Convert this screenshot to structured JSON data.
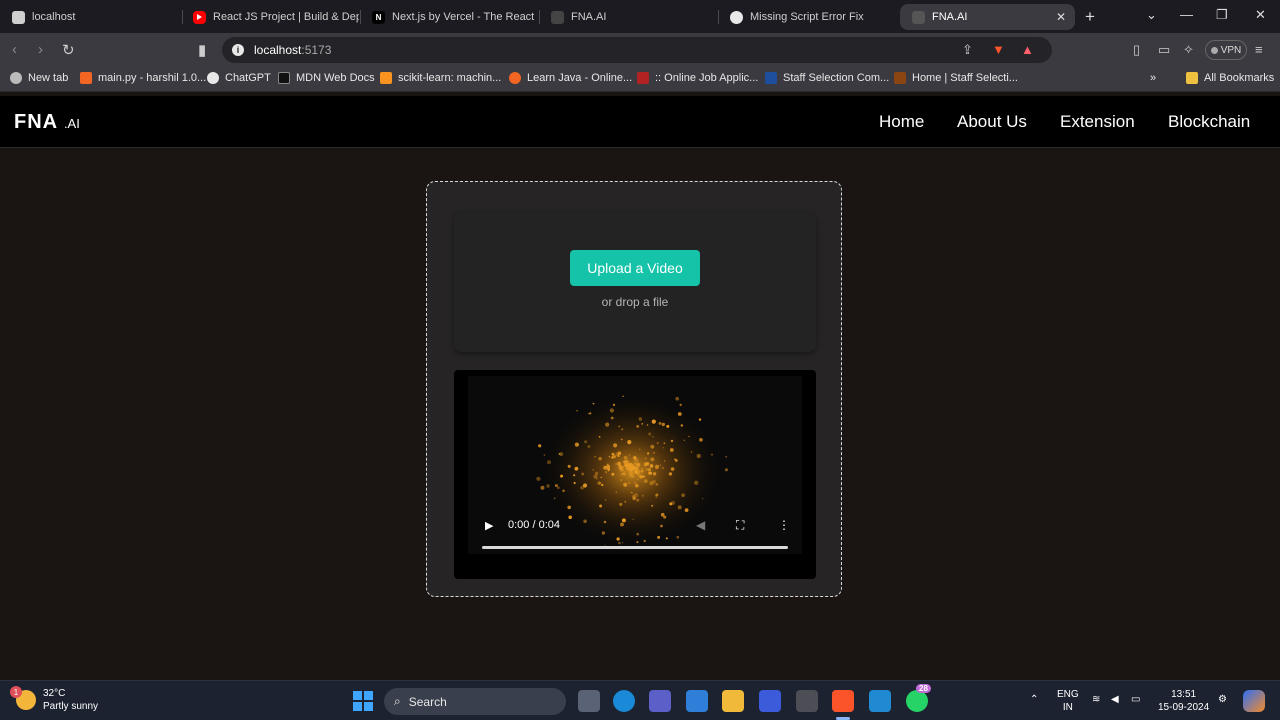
{
  "browser": {
    "tabs": [
      {
        "title": "localhost",
        "fav_color": "#cfcfcf",
        "fav_text": ""
      },
      {
        "title": "React JS Project | Build & Deplo",
        "fav_color": "#ff0000",
        "fav_text": ""
      },
      {
        "title": "Next.js by Vercel - The React Fr",
        "fav_color": "#000000",
        "fav_text": "N"
      },
      {
        "title": "FNA.AI",
        "fav_color": "#444444",
        "fav_text": ""
      },
      {
        "title": "Missing Script Error Fix",
        "fav_color": "#e8e8e8",
        "fav_text": ""
      },
      {
        "title": "FNA.AI",
        "fav_color": "#444444",
        "fav_text": "",
        "active": true
      }
    ],
    "url_host": "localhost",
    "url_port": ":5173",
    "vpn_label": "VPN",
    "bookmarks": [
      {
        "label": "New tab",
        "color": "#bbbbbb"
      },
      {
        "label": "main.py - harshil 1.0...",
        "color": "#f26522"
      },
      {
        "label": "ChatGPT",
        "color": "#e8e8e8"
      },
      {
        "label": "MDN Web Docs",
        "color": "#111111"
      },
      {
        "label": "scikit-learn: machin...",
        "color": "#f7931e"
      },
      {
        "label": "Learn Java - Online...",
        "color": "#f26522"
      },
      {
        "label": ":: Online Job Applic...",
        "color": "#b22222"
      },
      {
        "label": "Staff Selection Com...",
        "color": "#1e4f9e"
      },
      {
        "label": "Home | Staff Selecti...",
        "color": "#8b4513"
      }
    ],
    "all_bookmarks_label": "All Bookmarks"
  },
  "site": {
    "logo_main": "FNA",
    "logo_suffix": ".AI",
    "nav": [
      "Home",
      "About Us",
      "Extension",
      "Blockchain"
    ],
    "upload_button": "Upload a Video",
    "drop_text": "or drop a file",
    "video_time": "0:00 / 0:04",
    "accent_color": "#14c3a8"
  },
  "taskbar": {
    "temperature": "32°C",
    "weather": "Partly sunny",
    "weather_badge": "1",
    "search_placeholder": "Search",
    "whatsapp_badge": "28",
    "lang_top": "ENG",
    "lang_bottom": "IN",
    "time": "13:51",
    "date": "15-09-2024"
  }
}
